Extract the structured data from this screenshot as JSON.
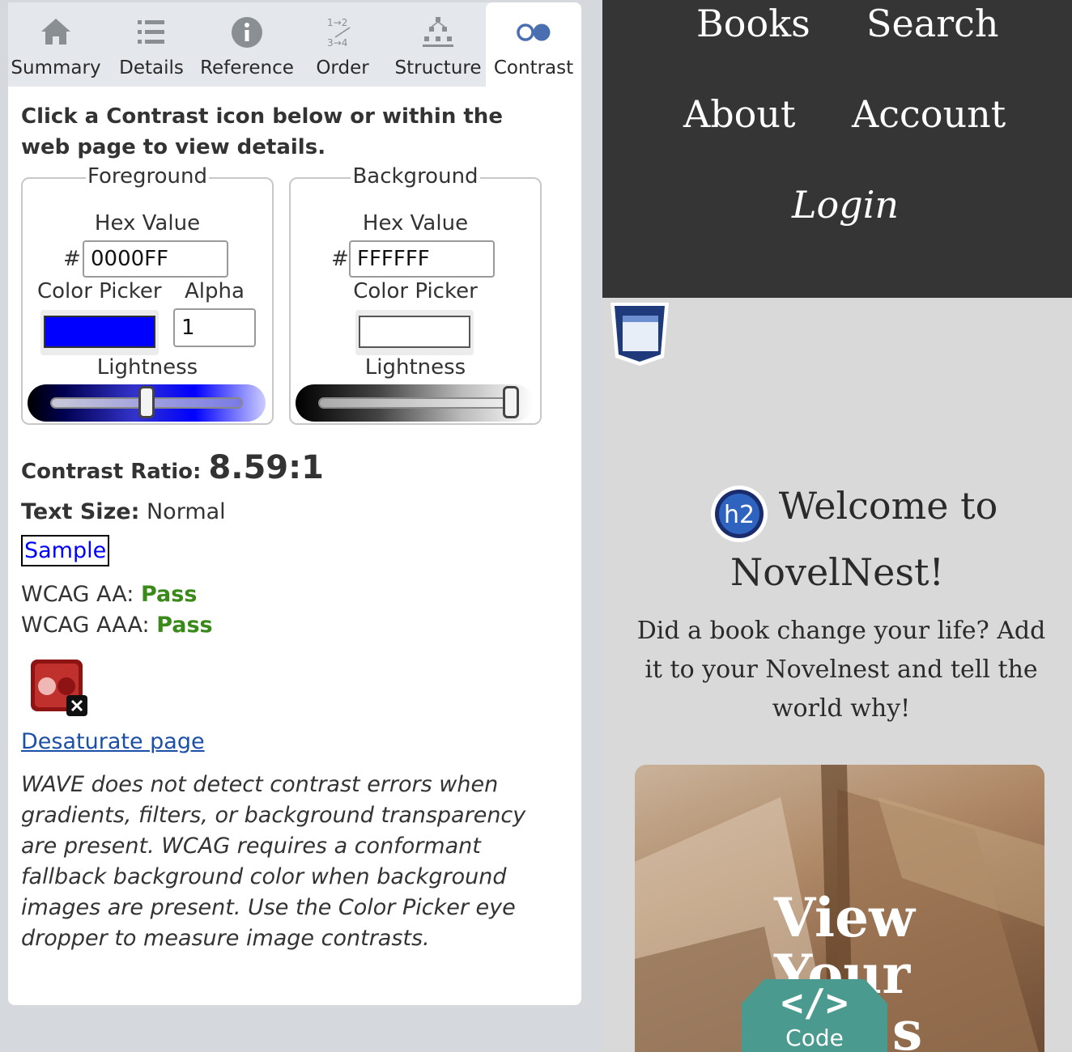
{
  "tabs": [
    {
      "label": "Summary",
      "icon": "home-icon"
    },
    {
      "label": "Details",
      "icon": "list-icon"
    },
    {
      "label": "Reference",
      "icon": "info-icon"
    },
    {
      "label": "Order",
      "icon": "order-icon"
    },
    {
      "label": "Structure",
      "icon": "structure-icon"
    },
    {
      "label": "Contrast",
      "icon": "contrast-icon",
      "active": true
    }
  ],
  "contrast": {
    "intro": "Click a Contrast icon below or within the web page to view details.",
    "foreground": {
      "legend": "Foreground",
      "hex_label": "Hex Value",
      "hash": "#",
      "hex_value": "0000FF",
      "picker_label": "Color Picker",
      "alpha_label": "Alpha",
      "alpha_value": "1",
      "lightness_label": "Lightness",
      "lightness_level": 0.5,
      "color": "#0000ff"
    },
    "background": {
      "legend": "Background",
      "hex_label": "Hex Value",
      "hash": "#",
      "hex_value": "FFFFFF",
      "picker_label": "Color Picker",
      "lightness_label": "Lightness",
      "lightness_level": 1.0,
      "color": "#ffffff"
    },
    "ratio_label": "Contrast Ratio:",
    "ratio_value": "8.59:1",
    "text_size_label": "Text Size:",
    "text_size_value": "Normal",
    "sample": "Sample",
    "wcag_aa_label": "WCAG AA:",
    "wcag_aa_value": "Pass",
    "wcag_aaa_label": "WCAG AAA:",
    "wcag_aaa_value": "Pass",
    "desaturate_link": "Desaturate page",
    "note": "WAVE does not detect contrast errors when gradients, filters, or background transparency are present. WCAG requires a conformant fallback background color when background images are present. Use the Color Picker eye dropper to measure image contrasts."
  },
  "site": {
    "nav": {
      "books": "Books",
      "search": "Search",
      "about": "About",
      "account": "Account",
      "login": "Login"
    },
    "h2_badge": "h2",
    "welcome_line1": "Welcome to",
    "welcome_line2": "NovelNest!",
    "tagline": "Did a book change your life? Add it to your Novelnest and tell the world why!",
    "hero_line1": "View",
    "hero_line2": "Your",
    "hero_line3": "s",
    "code_button": "Code",
    "code_glyph": "</>"
  },
  "colors": {
    "accent": "#2a3f9a",
    "pass_green": "#3a8a1a",
    "nav_bg": "#353535",
    "code_button": "#4a9a8f"
  }
}
